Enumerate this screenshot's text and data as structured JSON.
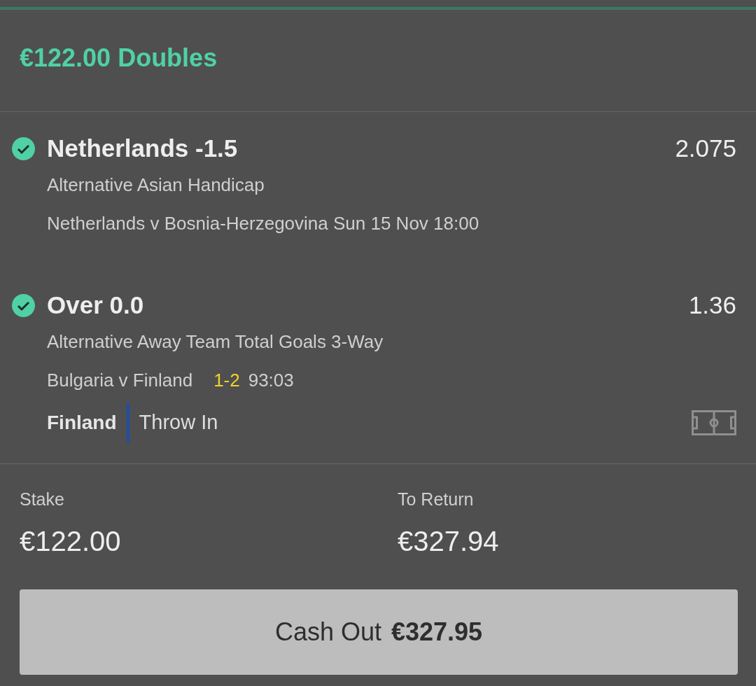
{
  "header": {
    "stake": "€122.00",
    "bet_type": "Doubles"
  },
  "selections": [
    {
      "won": true,
      "name": "Netherlands -1.5",
      "odds": "2.075",
      "market": "Alternative Asian Handicap",
      "event": "Netherlands v Bosnia-Herzegovina Sun 15 Nov 18:00"
    },
    {
      "won": true,
      "name": "Over 0.0",
      "odds": "1.36",
      "market": "Alternative Away Team Total Goals 3-Way",
      "event": "Bulgaria v Finland",
      "score": "1-2",
      "clock": "93:03",
      "live_team": "Finland",
      "live_action": "Throw In"
    }
  ],
  "summary": {
    "stake_label": "Stake",
    "stake_value": "€122.00",
    "return_label": "To Return",
    "return_value": "€327.94"
  },
  "cash_out": {
    "label": "Cash Out",
    "amount": "€327.95"
  }
}
